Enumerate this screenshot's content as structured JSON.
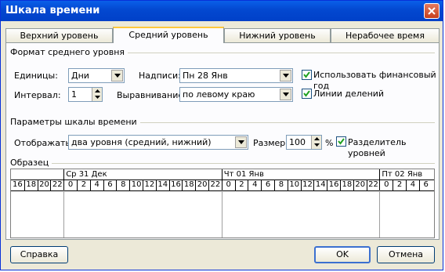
{
  "window": {
    "title": "Шкала времени"
  },
  "tabs": [
    {
      "label": "Верхний уровень"
    },
    {
      "label": "Средний уровень"
    },
    {
      "label": "Нижний уровень"
    },
    {
      "label": "Нерабочее время"
    }
  ],
  "format": {
    "group_title": "Формат среднего уровня",
    "units_label": "Единицы:",
    "units_value": "Дни",
    "labels_label": "Надписи:",
    "labels_value": "Пн 28 Янв",
    "fiscal_label": "Использовать финансовый год",
    "fiscal_checked": true,
    "interval_label": "Интервал:",
    "interval_value": "1",
    "align_label": "Выравнивание:",
    "align_value": "по левому краю",
    "ticks_label": "Линии делений",
    "ticks_checked": true
  },
  "scale": {
    "group_title": "Параметры шкалы времени",
    "show_label": "Отображать:",
    "show_value": "два уровня (средний, нижний)",
    "size_label": "Размер:",
    "size_value": "100",
    "size_unit": "%",
    "separator_label": "Разделитель уровней",
    "separator_checked": true
  },
  "sample": {
    "group_title": "Образец",
    "top_tier": [
      "Ср 31 Дек",
      "Чт 01 Янв",
      "Пт 02 Янв"
    ],
    "bottom_tier": [
      "16",
      "18",
      "20",
      "22",
      "0",
      "2",
      "4",
      "6",
      "8",
      "10",
      "12",
      "14",
      "16",
      "18",
      "20",
      "22",
      "0",
      "2",
      "4",
      "6",
      "8",
      "10",
      "12",
      "14",
      "16",
      "18",
      "20",
      "22",
      "0",
      "2",
      "4",
      "6"
    ]
  },
  "buttons": {
    "help": "Справка",
    "ok": "OK",
    "cancel": "Отмена"
  }
}
